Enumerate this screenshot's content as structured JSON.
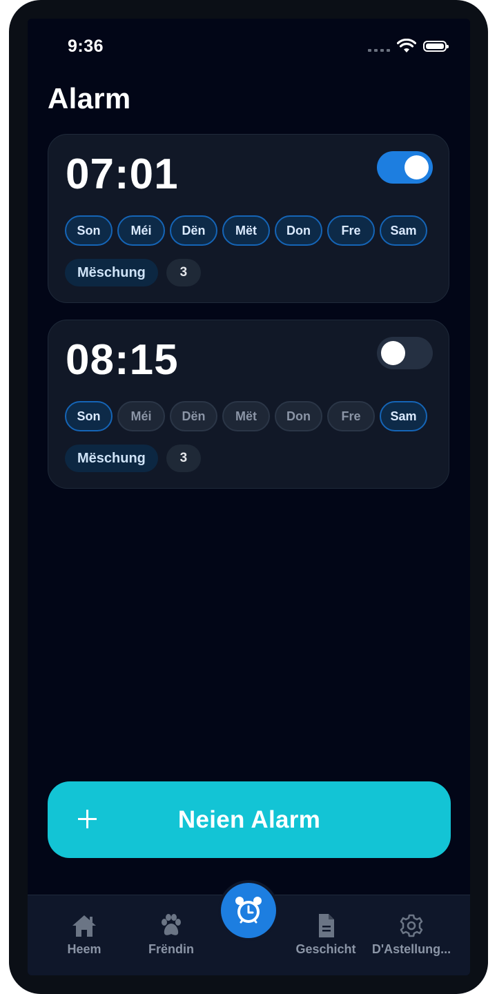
{
  "status_bar": {
    "time": "9:36"
  },
  "page_title": "Alarm",
  "alarms": [
    {
      "time": "07:01",
      "enabled": true,
      "days": [
        {
          "label": "Son",
          "active": true
        },
        {
          "label": "Méi",
          "active": true
        },
        {
          "label": "Dën",
          "active": true
        },
        {
          "label": "Mët",
          "active": true
        },
        {
          "label": "Don",
          "active": true
        },
        {
          "label": "Fre",
          "active": true
        },
        {
          "label": "Sam",
          "active": true
        }
      ],
      "tag_label": "Mëschung",
      "tag_count": "3"
    },
    {
      "time": "08:15",
      "enabled": false,
      "days": [
        {
          "label": "Son",
          "active": true
        },
        {
          "label": "Méi",
          "active": false
        },
        {
          "label": "Dën",
          "active": false
        },
        {
          "label": "Mët",
          "active": false
        },
        {
          "label": "Don",
          "active": false
        },
        {
          "label": "Fre",
          "active": false
        },
        {
          "label": "Sam",
          "active": true
        }
      ],
      "tag_label": "Mëschung",
      "tag_count": "3"
    }
  ],
  "new_alarm_button": {
    "label": "Neien Alarm",
    "icon": "plus-icon"
  },
  "tabbar": {
    "items": [
      {
        "label": "Heem",
        "icon": "home-icon"
      },
      {
        "label": "Frëndin",
        "icon": "paw-icon"
      },
      {
        "label": "",
        "icon": "alarm-clock-icon",
        "selected": true
      },
      {
        "label": "Geschicht",
        "icon": "document-icon"
      },
      {
        "label": "D'Astellung...",
        "icon": "gear-icon"
      }
    ]
  },
  "colors": {
    "background": "#020617",
    "card": "#111827",
    "accent_blue": "#1d7ee0",
    "accent_cyan": "#13c4d5"
  }
}
